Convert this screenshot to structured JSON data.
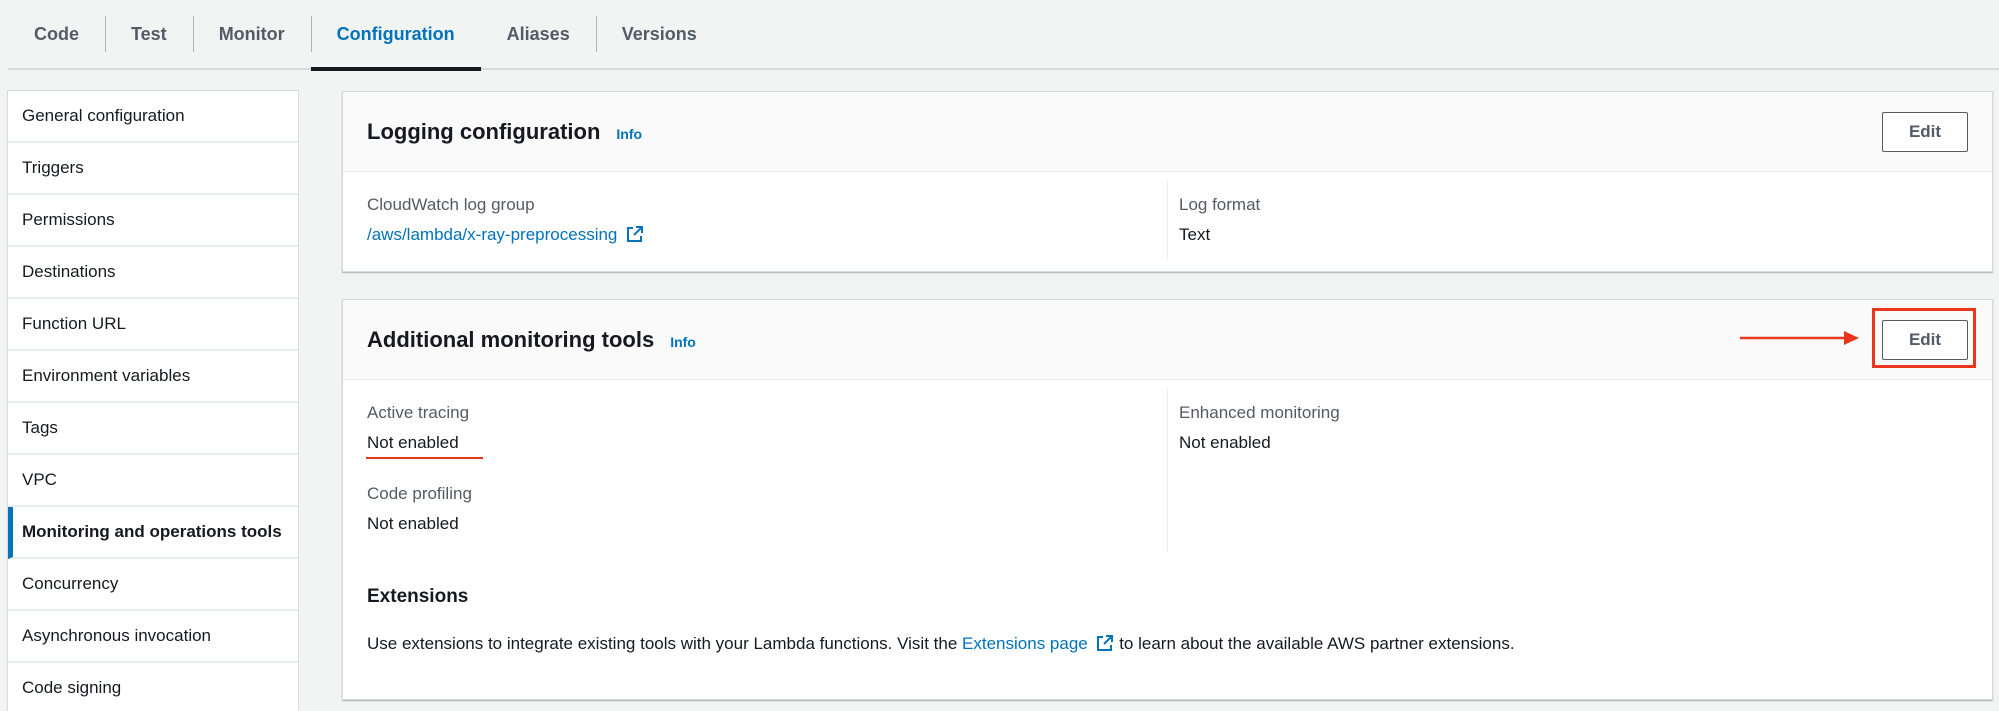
{
  "tabs": [
    {
      "label": "Code",
      "active": false
    },
    {
      "label": "Test",
      "active": false
    },
    {
      "label": "Monitor",
      "active": false
    },
    {
      "label": "Configuration",
      "active": true
    },
    {
      "label": "Aliases",
      "active": false
    },
    {
      "label": "Versions",
      "active": false
    }
  ],
  "sidebar": {
    "items": [
      {
        "label": "General configuration"
      },
      {
        "label": "Triggers"
      },
      {
        "label": "Permissions"
      },
      {
        "label": "Destinations"
      },
      {
        "label": "Function URL"
      },
      {
        "label": "Environment variables"
      },
      {
        "label": "Tags"
      },
      {
        "label": "VPC"
      },
      {
        "label": "Monitoring and operations tools",
        "active": true
      },
      {
        "label": "Concurrency"
      },
      {
        "label": "Asynchronous invocation"
      },
      {
        "label": "Code signing"
      }
    ]
  },
  "logging": {
    "title": "Logging configuration",
    "info": "Info",
    "edit": "Edit",
    "log_group_label": "CloudWatch log group",
    "log_group_value": "/aws/lambda/x-ray-preprocessing",
    "log_format_label": "Log format",
    "log_format_value": "Text"
  },
  "monitoring": {
    "title": "Additional monitoring tools",
    "info": "Info",
    "edit": "Edit",
    "active_tracing_label": "Active tracing",
    "active_tracing_value": "Not enabled",
    "code_profiling_label": "Code profiling",
    "code_profiling_value": "Not enabled",
    "enhanced_monitoring_label": "Enhanced monitoring",
    "enhanced_monitoring_value": "Not enabled",
    "extensions_title": "Extensions",
    "extensions_text_before": "Use extensions to integrate existing tools with your Lambda functions. Visit the",
    "extensions_link": "Extensions page",
    "extensions_text_after": "to learn about the available AWS partner extensions."
  },
  "colors": {
    "accent": "#0073bb",
    "annotation": "#e8371c"
  }
}
